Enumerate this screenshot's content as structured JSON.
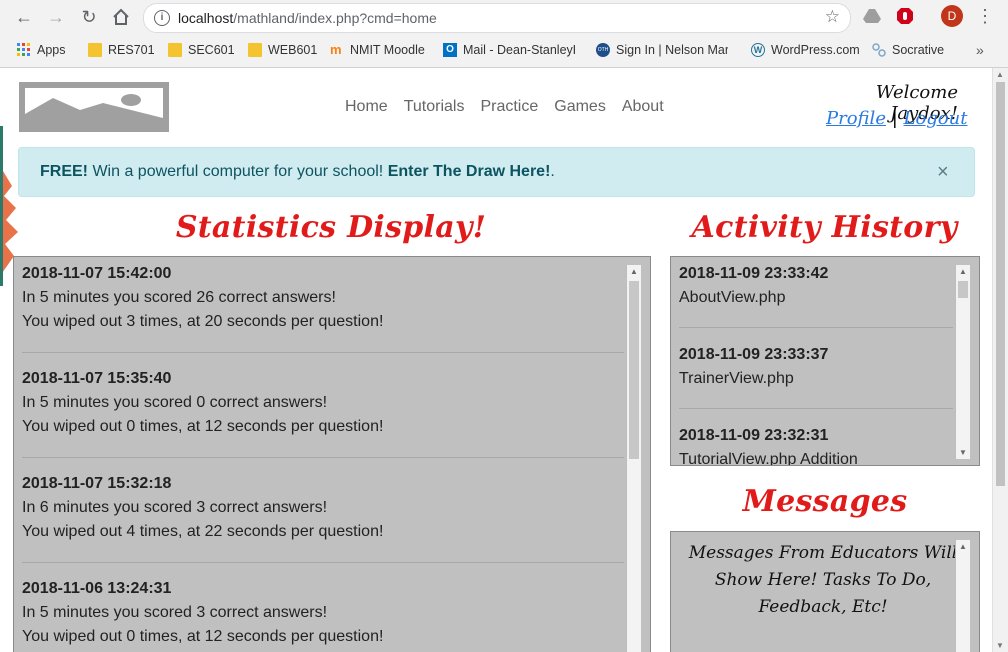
{
  "browser": {
    "url_host": "localhost",
    "url_path": "/mathland/index.php?cmd=home",
    "profile_initial": "D",
    "bookmarks": [
      {
        "label": "Apps",
        "icon": "apps-grid-icon"
      },
      {
        "label": "RES701",
        "icon": "folder-icon"
      },
      {
        "label": "SEC601",
        "icon": "folder-icon"
      },
      {
        "label": "WEB601",
        "icon": "folder-icon"
      },
      {
        "label": "NMIT Moodle",
        "icon": "moodle-icon"
      },
      {
        "label": "Mail - Dean-StanleyH",
        "icon": "outlook-icon"
      },
      {
        "label": "Sign In | Nelson Marl",
        "icon": "oth-icon"
      },
      {
        "label": "WordPress.com",
        "icon": "wordpress-icon"
      },
      {
        "label": "Socrative",
        "icon": "socrative-icon"
      }
    ]
  },
  "header": {
    "nav": [
      "Home",
      "Tutorials",
      "Practice",
      "Games",
      "About"
    ],
    "welcome": "Welcome Jaydox!",
    "profile_link": "Profile",
    "separator": "|",
    "logout_link": "Logout"
  },
  "alert": {
    "bold_prefix": "FREE!",
    "text": " Win a powerful computer for your school! ",
    "link": "Enter The Draw Here!",
    "suffix": ".",
    "close": "×"
  },
  "statistics": {
    "title": "Statistics Display!",
    "entries": [
      {
        "timestamp": "2018-11-07 15:42:00",
        "line1": "In 5 minutes you scored 26 correct answers!",
        "line2": "You wiped out 3 times, at 20 seconds per question!"
      },
      {
        "timestamp": "2018-11-07 15:35:40",
        "line1": "In 5 minutes you scored 0 correct answers!",
        "line2": "You wiped out 0 times, at 12 seconds per question!"
      },
      {
        "timestamp": "2018-11-07 15:32:18",
        "line1": "In 6 minutes you scored 3 correct answers!",
        "line2": "You wiped out 4 times, at 22 seconds per question!"
      },
      {
        "timestamp": "2018-11-06 13:24:31",
        "line1": "In 5 minutes you scored 3 correct answers!",
        "line2": "You wiped out 0 times, at 12 seconds per question!"
      }
    ]
  },
  "activity": {
    "title": "Activity History",
    "entries": [
      {
        "timestamp": "2018-11-09 23:33:42",
        "page": "AboutView.php"
      },
      {
        "timestamp": "2018-11-09 23:33:37",
        "page": "TrainerView.php"
      },
      {
        "timestamp": "2018-11-09 23:32:31",
        "page": "TutorialView.php Addition"
      }
    ]
  },
  "messages": {
    "title": "Messages",
    "text": "Messages From Educators Will Show Here! Tasks To Do, Feedback, Etc!"
  },
  "colors": {
    "heading_red": "#e11a1a",
    "panel_gray": "#c0c0c0",
    "alert_bg": "#d1ecf1",
    "link_blue": "#2a7ae2"
  }
}
